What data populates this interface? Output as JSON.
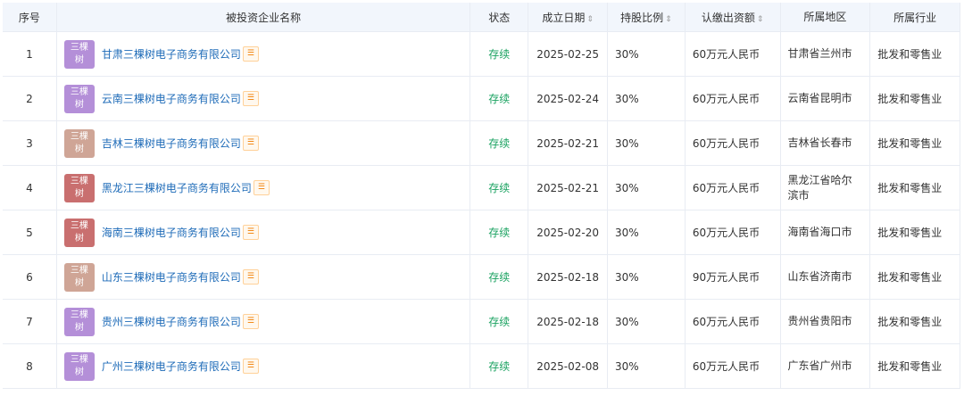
{
  "headers": {
    "idx": "序号",
    "name": "被投资企业名称",
    "status": "状态",
    "date": "成立日期",
    "pct": "持股比例",
    "capital": "认缴出资额",
    "region": "所属地区",
    "industry": "所属行业"
  },
  "sort_icon": "⇕",
  "tag_icon": "org-chart-icon",
  "logo_text_top": "三棵",
  "logo_text_bottom": "树",
  "rows": [
    {
      "idx": "1",
      "name": "甘肃三棵树电子商务有限公司",
      "status": "存续",
      "date": "2025-02-25",
      "pct": "30%",
      "capital": "60万元人民币",
      "region": "甘肃省兰州市",
      "industry": "批发和零售业",
      "logo_color": "#b48fd8"
    },
    {
      "idx": "2",
      "name": "云南三棵树电子商务有限公司",
      "status": "存续",
      "date": "2025-02-24",
      "pct": "30%",
      "capital": "60万元人民币",
      "region": "云南省昆明市",
      "industry": "批发和零售业",
      "logo_color": "#b48fd8"
    },
    {
      "idx": "3",
      "name": "吉林三棵树电子商务有限公司",
      "status": "存续",
      "date": "2025-02-21",
      "pct": "30%",
      "capital": "60万元人民币",
      "region": "吉林省长春市",
      "industry": "批发和零售业",
      "logo_color": "#cfa596"
    },
    {
      "idx": "4",
      "name": "黑龙江三棵树电子商务有限公司",
      "status": "存续",
      "date": "2025-02-21",
      "pct": "30%",
      "capital": "60万元人民币",
      "region": "黑龙江省哈尔滨市",
      "industry": "批发和零售业",
      "logo_color": "#c96f6f"
    },
    {
      "idx": "5",
      "name": "海南三棵树电子商务有限公司",
      "status": "存续",
      "date": "2025-02-20",
      "pct": "30%",
      "capital": "60万元人民币",
      "region": "海南省海口市",
      "industry": "批发和零售业",
      "logo_color": "#c96f6f"
    },
    {
      "idx": "6",
      "name": "山东三棵树电子商务有限公司",
      "status": "存续",
      "date": "2025-02-18",
      "pct": "30%",
      "capital": "90万元人民币",
      "region": "山东省济南市",
      "industry": "批发和零售业",
      "logo_color": "#cfa596"
    },
    {
      "idx": "7",
      "name": "贵州三棵树电子商务有限公司",
      "status": "存续",
      "date": "2025-02-18",
      "pct": "30%",
      "capital": "60万元人民币",
      "region": "贵州省贵阳市",
      "industry": "批发和零售业",
      "logo_color": "#b48fd8"
    },
    {
      "idx": "8",
      "name": "广州三棵树电子商务有限公司",
      "status": "存续",
      "date": "2025-02-08",
      "pct": "30%",
      "capital": "60万元人民币",
      "region": "广东省广州市",
      "industry": "批发和零售业",
      "logo_color": "#b48fd8"
    }
  ]
}
